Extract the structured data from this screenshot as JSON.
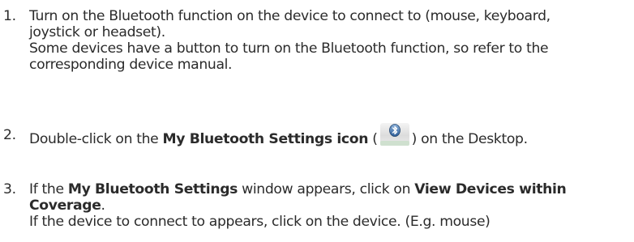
{
  "steps": [
    {
      "number": "1.",
      "lines": [
        "Turn on the Bluetooth function on the device to connect to (mouse, keyboard,",
        "joystick or headset)."
      ],
      "note_lines": [
        "Some devices have a button to turn on the Bluetooth function, so refer to the",
        "corresponding device manual."
      ]
    },
    {
      "number": "2.",
      "text_before": "Double-click on the ",
      "bold": "My Bluetooth Settings icon",
      "text_paren_open": " (",
      "icon": "bluetooth-settings-icon",
      "text_after": ") on the Desktop."
    },
    {
      "number": "3.",
      "text_before": "If the ",
      "bold1": "My Bluetooth Settings",
      "text_mid": " window appears, click on ",
      "bold2_line1": "View Devices within",
      "bold2_line2": "Coverage",
      "period": ".",
      "note": "If the device to connect to appears, click on the device. (E.g. mouse)"
    }
  ]
}
